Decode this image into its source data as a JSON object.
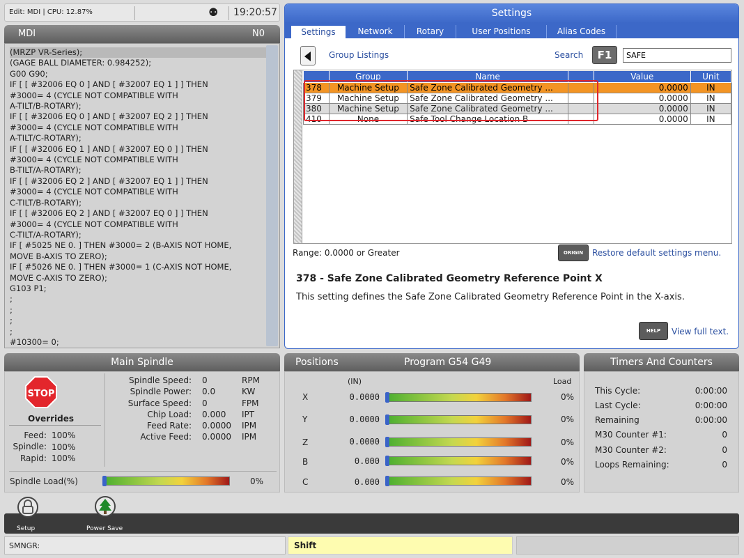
{
  "status": {
    "edit": "Edit: MDI | CPU: 12.87%",
    "clock": "19:20:57"
  },
  "mdi": {
    "title": "MDI",
    "n": "N0",
    "lines": [
      "(MRZP VR-Series);",
      "(GAGE BALL DIAMETER: 0.984252);",
      "G00 G90;",
      "IF [ [ #32006 EQ 0 ] AND [ #32007 EQ 1 ] ] THEN",
      "#3000= 4 (CYCLE NOT COMPATIBLE WITH",
      "A-TILT/B-ROTARY);",
      "IF [ [ #32006 EQ 0 ] AND [ #32007 EQ 2 ] ] THEN",
      "#3000= 4 (CYCLE NOT COMPATIBLE WITH",
      "A-TILT/C-ROTARY);",
      "IF [ [ #32006 EQ 1 ] AND [ #32007 EQ 0 ] ] THEN",
      "#3000= 4 (CYCLE NOT COMPATIBLE WITH",
      "B-TILT/A-ROTARY);",
      "IF [ [ #32006 EQ 2 ] AND [ #32007 EQ 1 ] ] THEN",
      "#3000= 4 (CYCLE NOT COMPATIBLE WITH",
      "C-TILT/B-ROTARY);",
      "IF [ [ #32006 EQ 2 ] AND [ #32007 EQ 0 ] ] THEN",
      "#3000= 4 (CYCLE NOT COMPATIBLE WITH",
      "C-TILT/A-ROTARY);",
      "IF [ #5025 NE 0. ] THEN #3000= 2 (B-AXIS NOT HOME,",
      "MOVE B-AXIS TO ZERO);",
      "IF [ #5026 NE 0. ] THEN #3000= 1 (C-AXIS NOT HOME,",
      "MOVE C-AXIS TO ZERO);",
      "G103 P1;",
      ";",
      ";",
      ";",
      ";",
      "#10300= 0;"
    ]
  },
  "settings": {
    "title": "Settings",
    "tabs": [
      "Settings",
      "Network",
      "Rotary",
      "User Positions",
      "Alias Codes"
    ],
    "group_listings": "Group Listings",
    "search_label": "Search",
    "f1": "F1",
    "search_value": "SAFE",
    "columns": [
      "",
      "Group",
      "Name",
      "",
      "Value",
      "Unit"
    ],
    "rows": [
      {
        "num": "378",
        "group": "Machine Setup",
        "name": "Safe Zone Calibrated Geometry ...",
        "value": "0.0000",
        "unit": "IN"
      },
      {
        "num": "379",
        "group": "Machine Setup",
        "name": "Safe Zone Calibrated Geometry ...",
        "value": "0.0000",
        "unit": "IN"
      },
      {
        "num": "380",
        "group": "Machine Setup",
        "name": "Safe Zone Calibrated Geometry ...",
        "value": "0.0000",
        "unit": "IN"
      },
      {
        "num": "410",
        "group": "None",
        "name": "Safe Tool Change Location B",
        "value": "0.0000",
        "unit": "IN"
      }
    ],
    "range": "Range: 0.0000 or Greater",
    "origin": "ORIGIN",
    "restore": "Restore default settings menu.",
    "desc_title": "378 - Safe Zone Calibrated Geometry Reference Point X",
    "desc_text": "This setting defines the Safe Zone Calibrated Geometry Reference Point in the X-axis.",
    "help": "HELP",
    "view_full": "View full text."
  },
  "spindle": {
    "title": "Main Spindle",
    "stop": "STOP",
    "overrides": "Overrides",
    "ovr": [
      {
        "label": "Feed:",
        "value": "100%"
      },
      {
        "label": "Spindle:",
        "value": "100%"
      },
      {
        "label": "Rapid:",
        "value": "100%"
      }
    ],
    "params": [
      {
        "label": "Spindle Speed:",
        "value": "0",
        "unit": "RPM"
      },
      {
        "label": "Spindle Power:",
        "value": "0.0",
        "unit": "KW"
      },
      {
        "label": "Surface Speed:",
        "value": "0",
        "unit": "FPM"
      },
      {
        "label": "Chip Load:",
        "value": "0.000",
        "unit": "IPT"
      },
      {
        "label": "Feed Rate:",
        "value": "0.0000",
        "unit": "IPM"
      },
      {
        "label": "Active Feed:",
        "value": "0.0000",
        "unit": "IPM"
      }
    ],
    "load_label": "Spindle Load(%)",
    "load_value": "0%",
    "load_fraction": 0
  },
  "positions": {
    "title": "Positions",
    "program": "Program G54 G49",
    "units": "(IN)",
    "load_header": "Load",
    "axes": [
      {
        "axis": "X",
        "value": "0.0000",
        "load": "0%"
      },
      {
        "axis": "Y",
        "value": "0.0000",
        "load": "0%"
      },
      {
        "axis": "Z",
        "value": "0.0000",
        "load": "0%"
      },
      {
        "axis": "B",
        "value": "0.000",
        "load": "0%"
      },
      {
        "axis": "C",
        "value": "0.000",
        "load": "0%"
      }
    ]
  },
  "timers": {
    "title": "Timers And Counters",
    "items": [
      {
        "label": "This Cycle:",
        "value": "0:00:00"
      },
      {
        "label": "Last Cycle:",
        "value": "0:00:00"
      },
      {
        "label": "Remaining",
        "value": "0:00:00"
      },
      {
        "label": "M30 Counter #1:",
        "value": "0"
      },
      {
        "label": "M30 Counter #2:",
        "value": "0"
      },
      {
        "label": "Loops Remaining:",
        "value": "0"
      }
    ]
  },
  "dock": {
    "setup": "Setup",
    "power_save": "Power Save"
  },
  "bottom": {
    "smngr": "SMNGR:",
    "shift": "Shift"
  }
}
